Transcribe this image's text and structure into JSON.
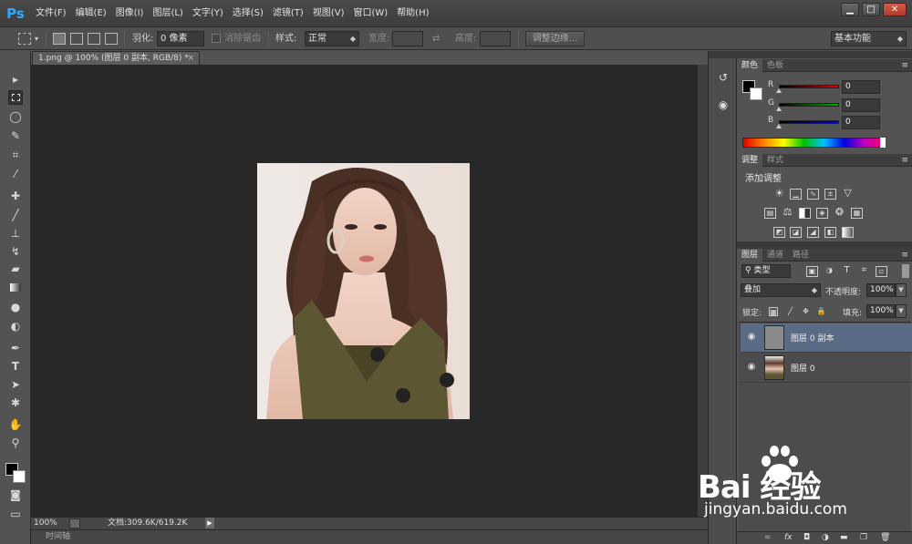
{
  "app": {
    "logo": "Ps"
  },
  "menu": [
    "文件(F)",
    "编辑(E)",
    "图像(I)",
    "图层(L)",
    "文字(Y)",
    "选择(S)",
    "滤镜(T)",
    "视图(V)",
    "窗口(W)",
    "帮助(H)"
  ],
  "window_controls": {
    "minimize": "▁",
    "maximize": "□",
    "close": "✕"
  },
  "options_bar": {
    "feather_label": "羽化:",
    "feather_value": "0 像素",
    "antialias_label": "消除锯齿",
    "style_label": "样式:",
    "style_value": "正常",
    "width_label": "宽度:",
    "height_label": "高度:",
    "refine_edge_button": "调整边缘...",
    "workspace_value": "基本功能"
  },
  "document": {
    "tab_title": "1.png @ 100% (图层 0 副本, RGB/8) *",
    "tab_close": "×"
  },
  "status_bar": {
    "zoom": "100%",
    "doc_info": "文档:309.6K/619.2K"
  },
  "timeline_label": "时间轴",
  "color_panel": {
    "tabs": [
      "颜色",
      "色板"
    ],
    "channels": [
      {
        "label": "R",
        "value": "0",
        "color": "#e00000"
      },
      {
        "label": "G",
        "value": "0",
        "color": "#00b000"
      },
      {
        "label": "B",
        "value": "0",
        "color": "#0000e0"
      }
    ]
  },
  "adjustments_panel": {
    "tabs": [
      "调整",
      "样式"
    ],
    "heading": "添加调整",
    "icons": [
      "brightness-icon",
      "levels-icon",
      "curves-icon",
      "exposure-icon",
      "vibrance-icon",
      "hue-saturation-icon",
      "color-balance-icon",
      "black-white-icon",
      "photo-filter-icon",
      "channel-mixer-icon",
      "color-lookup-icon",
      "invert-icon",
      "posterize-icon",
      "threshold-icon",
      "selective-color-icon",
      "gradient-map-icon"
    ]
  },
  "layers_panel": {
    "tabs": [
      "图层",
      "通道",
      "路径"
    ],
    "filter_value": "类型",
    "blend_mode": "叠加",
    "opacity_label": "不透明度:",
    "opacity_value": "100%",
    "lock_label": "锁定:",
    "fill_label": "填充:",
    "fill_value": "100%",
    "layers": [
      {
        "name": "图层 0 副本",
        "selected": true
      },
      {
        "name": "图层 0",
        "selected": false
      }
    ],
    "footer_icons": [
      "link-icon",
      "fx-icon",
      "mask-icon",
      "adjustment-layer-icon",
      "group-icon",
      "new-layer-icon",
      "trash-icon"
    ]
  },
  "watermark": {
    "brand": "Bai  经验",
    "url": "jingyan.baidu.com"
  }
}
